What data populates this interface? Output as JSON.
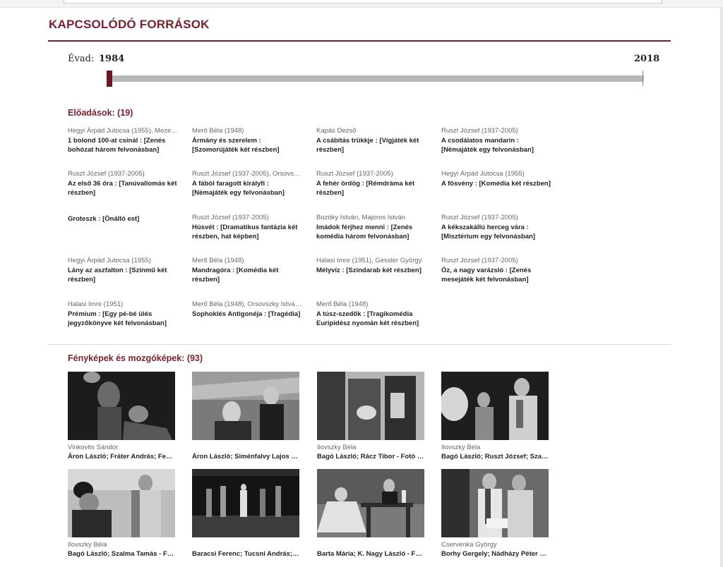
{
  "section_title": "KAPCSOLÓDÓ FORRÁSOK",
  "season": {
    "label": "Évad:",
    "start_year": "1984",
    "end_year": "2018"
  },
  "performances": {
    "heading": "Előadások: (19)",
    "items": [
      {
        "author": "Hegyi Árpád Jutocsa (1955), Meze…",
        "title": "1 bolond 100-at csinál : [Zenés bohózat három felvonásban]"
      },
      {
        "author": "Merő Béla (1948)",
        "title": "Ármány és szerelem : [Szomorújáték két részben]"
      },
      {
        "author": "Kapás Dezső",
        "title": "A csábítás trükkje : [Vígjáték két részben]"
      },
      {
        "author": "Ruszt József (1937-2005)",
        "title": "A csodálatos mandarin : [Némajáték egy felvonásban]"
      },
      {
        "author": "Ruszt József (1937-2005)",
        "title": "Az első 36 óra : [Tanúvallomás két részben]"
      },
      {
        "author": "Ruszt József (1937-2005), Orsovs…",
        "title": "A fából faragott királyfi : [Némajáték egy felvonásban]"
      },
      {
        "author": "Ruszt József (1937-2005)",
        "title": "A fehér ördög : [Rémdráma két részben]"
      },
      {
        "author": "Hegyi Árpád Jutocsa (1955)",
        "title": "A fösvény : [Komédia két részben]"
      },
      {
        "author": "",
        "title": "Groteszk : [Önálló est]"
      },
      {
        "author": "Ruszt József (1937-2005)",
        "title": "Húsvét : [Dramatikus fantázia két részben, hat képben]"
      },
      {
        "author": "Bozóky István, Majoros István",
        "title": "Imádok férjhez menni : [Zenés komédia három felvonásban]"
      },
      {
        "author": "Ruszt József (1937-2005)",
        "title": "A kékszakállú herceg vára : [Misztérium egy felvonásban]"
      },
      {
        "author": "Hegyi Árpád Jutocsa (1955)",
        "title": "Lány az aszfalton : [Színmű két részben]"
      },
      {
        "author": "Merő Béla (1948)",
        "title": "Mandragóra : [Komédia két részben]"
      },
      {
        "author": "Halasi Imre (1951), Gessler György",
        "title": "Mélyvíz : [Színdarab két részben]"
      },
      {
        "author": "Ruszt József (1937-2005)",
        "title": "Óz, a nagy varázsló : [Zenés mesejáték két felvonásban]"
      },
      {
        "author": "Halasi Imre (1951)",
        "title": "Prémium : [Egy pé-bé ülés jegyzőkönyve két felvonásban]"
      },
      {
        "author": "Merő Béla (1948), Orsovszky Istvá…",
        "title": "Sophoklés Antigonéja : [Tragédia]"
      },
      {
        "author": "Merő Béla (1948)",
        "title": "A túsz-szedők : [Tragikomédia Euripidész nyomán két részben]"
      }
    ]
  },
  "photos": {
    "heading": "Fényképek és mozgóképek: (93)",
    "items": [
      {
        "author": "Vinkovits Sándor",
        "caption": "Áron László; Fráter András; Fek…"
      },
      {
        "author": "",
        "caption": "Áron László; Siménfalvy Lajos - …"
      },
      {
        "author": "Ilovszky Béla",
        "caption": "Bagó László; Rácz Tibor - Fotó :…"
      },
      {
        "author": "Ilovszky Béla",
        "caption": "Bagó László; Ruszt József; Szal…"
      },
      {
        "author": "Ilovszky Béla",
        "caption": "Bagó László; Szalma Tamás - Fo…"
      },
      {
        "author": "",
        "caption": "Baracsi Ferenc; Tucsni András; …"
      },
      {
        "author": "",
        "caption": "Barta Mária; K. Nagy László - Fo…"
      },
      {
        "author": "Cservenka György",
        "caption": "Borhy Gergely; Nádházy Péter - …"
      }
    ]
  }
}
